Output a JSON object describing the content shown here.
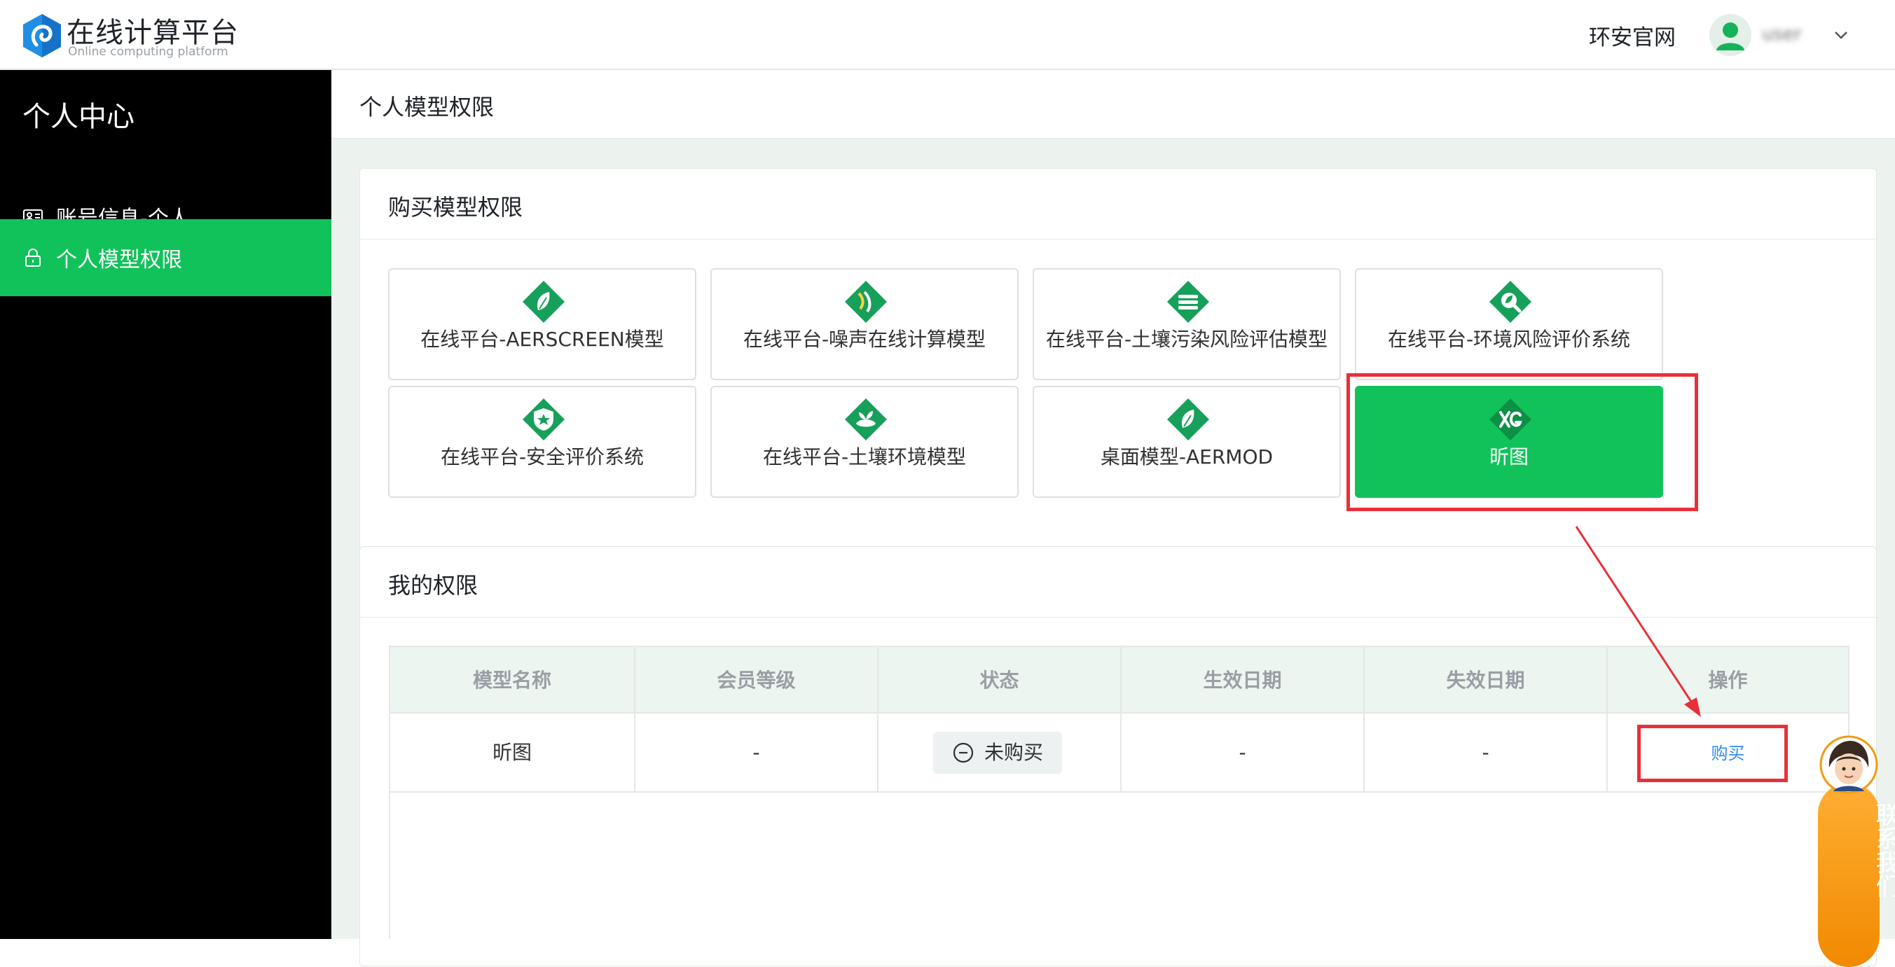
{
  "header": {
    "brand_title": "在线计算平台",
    "brand_subtitle": "Online computing platform",
    "official_link": "环安官网",
    "username": "user"
  },
  "sidebar": {
    "title": "个人中心",
    "items": [
      {
        "label": "账号信息-个人",
        "icon": "id-card-icon",
        "active": false
      },
      {
        "label": "个人模型权限",
        "icon": "lock-icon",
        "active": true
      }
    ]
  },
  "page": {
    "title": "个人模型权限"
  },
  "purchase_section": {
    "title": "购买模型权限",
    "models": [
      {
        "label": "在线平台-AERSCREEN模型",
        "icon": "leaf-icon"
      },
      {
        "label": "在线平台-噪声在线计算模型",
        "icon": "noise-wave-icon"
      },
      {
        "label": "在线平台-土壤污染风险评估模型",
        "icon": "soil-layers-icon"
      },
      {
        "label": "在线平台-环境风险评价系统",
        "icon": "magnifier-leaf-icon"
      },
      {
        "label": "在线平台-安全评价系统",
        "icon": "shield-star-icon"
      },
      {
        "label": "在线平台-土壤环境模型",
        "icon": "sprout-icon"
      },
      {
        "label": "桌面模型-AERMOD",
        "icon": "leaf-icon"
      },
      {
        "label": "昕图",
        "icon": "xg-logo-icon",
        "selected": true
      }
    ]
  },
  "permissions_section": {
    "title": "我的权限",
    "columns": [
      "模型名称",
      "会员等级",
      "状态",
      "生效日期",
      "失效日期",
      "操作"
    ],
    "rows": [
      {
        "name": "昕图",
        "level": "-",
        "status": "未购买",
        "start": "-",
        "end": "-",
        "action": "购买"
      }
    ]
  },
  "contact_widget": {
    "label": "联系我们"
  },
  "colors": {
    "accent": "#11c25a",
    "icon_green": "#16a05a",
    "annotation_red": "#e8303a",
    "link_blue": "#2d8cf0",
    "sidebar_bg": "#000000",
    "contact_orange": "#f39a12"
  }
}
